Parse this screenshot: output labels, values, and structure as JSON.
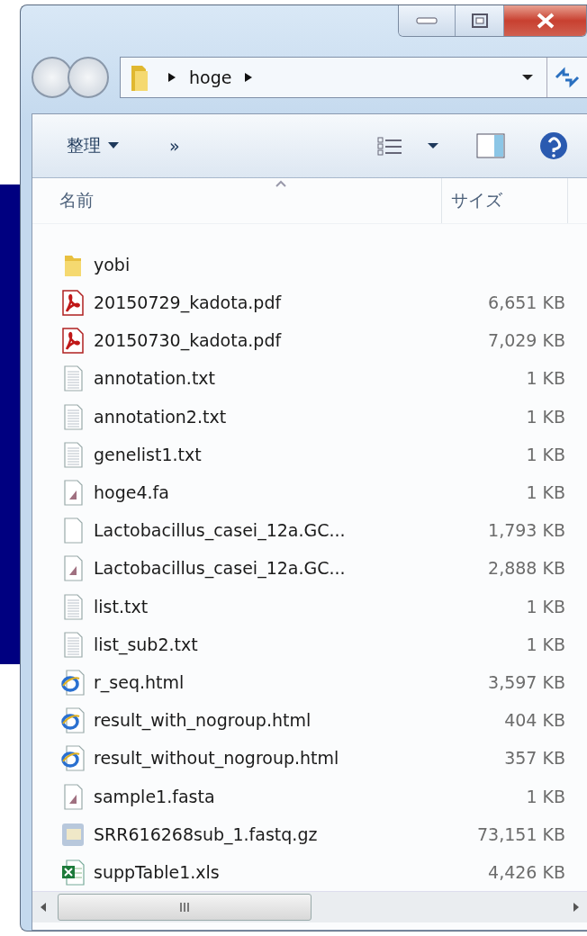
{
  "address_bar": {
    "path": "hoge"
  },
  "toolbar": {
    "organize": "整理",
    "more": "»"
  },
  "columns": [
    {
      "label": "名前"
    },
    {
      "label": "サイズ"
    }
  ],
  "files": [
    {
      "name": "yobi",
      "kind": "folder"
    },
    {
      "name": "20150729_kadota.pdf",
      "size": "6,651 KB",
      "kind": "pdf"
    },
    {
      "name": "20150730_kadota.pdf",
      "size": "7,029 KB",
      "kind": "pdf"
    },
    {
      "name": "annotation.txt",
      "size": "1 KB",
      "kind": "text"
    },
    {
      "name": "annotation2.txt",
      "size": "1 KB",
      "kind": "text"
    },
    {
      "name": "genelist1.txt",
      "size": "1 KB",
      "kind": "text"
    },
    {
      "name": "hoge4.fa",
      "size": "1 KB",
      "kind": "sequence"
    },
    {
      "name": "Lactobacillus_casei_12a.GC...",
      "size": "1,793 KB",
      "kind": "blank"
    },
    {
      "name": "Lactobacillus_casei_12a.GC...",
      "size": "2,888 KB",
      "kind": "sequence"
    },
    {
      "name": "list.txt",
      "size": "1 KB",
      "kind": "text"
    },
    {
      "name": "list_sub2.txt",
      "size": "1 KB",
      "kind": "text"
    },
    {
      "name": "r_seq.html",
      "size": "3,597 KB",
      "kind": "html"
    },
    {
      "name": "result_with_nogroup.html",
      "size": "404 KB",
      "kind": "html"
    },
    {
      "name": "result_without_nogroup.html",
      "size": "357 KB",
      "kind": "html"
    },
    {
      "name": "sample1.fasta",
      "size": "1 KB",
      "kind": "sequence"
    },
    {
      "name": "SRR616268sub_1.fastq.gz",
      "size": "73,151 KB",
      "kind": "archive"
    },
    {
      "name": "suppTable1.xls",
      "size": "4,426 KB",
      "kind": "excel"
    }
  ]
}
